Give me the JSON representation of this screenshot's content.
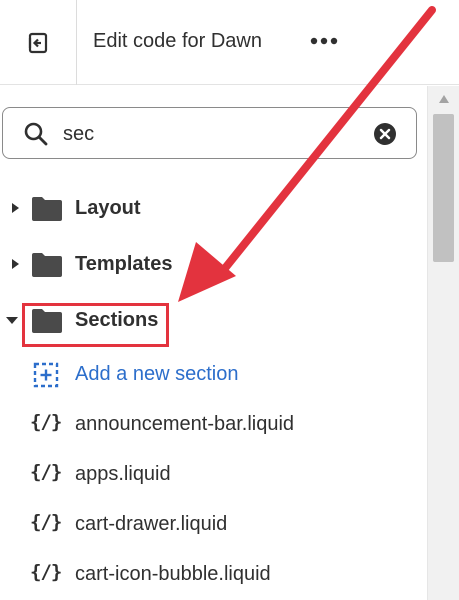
{
  "header": {
    "title": "Edit code for Dawn",
    "exit_icon": "exit-icon",
    "more_icon": "ellipsis-icon",
    "more_glyph": "•••"
  },
  "search": {
    "value": "sec",
    "search_icon": "search-icon",
    "clear_icon": "clear-icon"
  },
  "tree": {
    "folders": [
      {
        "label": "Layout",
        "expanded": false
      },
      {
        "label": "Templates",
        "expanded": false
      },
      {
        "label": "Sections",
        "expanded": true,
        "highlighted": true
      }
    ],
    "add_label": "Add a new section",
    "file_glyph": "{/}",
    "files": [
      "announcement-bar.liquid",
      "apps.liquid",
      "cart-drawer.liquid",
      "cart-icon-bubble.liquid"
    ]
  },
  "colors": {
    "annotation": "#e3333e",
    "link": "#2c6ecb",
    "folder": "#4a4a4a"
  }
}
